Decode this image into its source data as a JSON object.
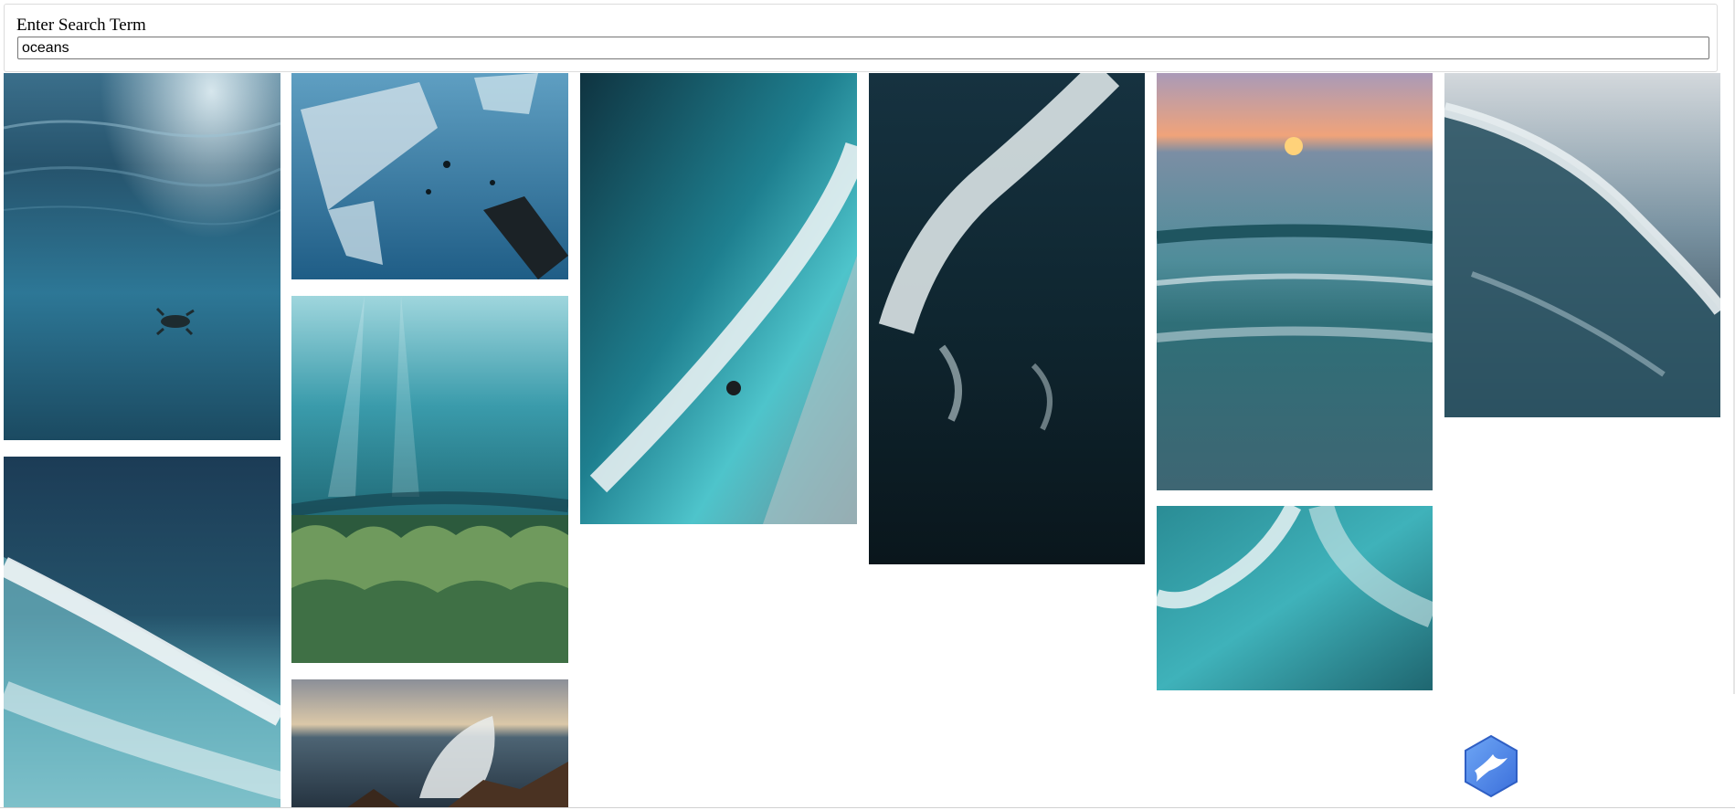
{
  "search": {
    "label": "Enter Search Term",
    "value": "oceans"
  },
  "gallery": {
    "images": [
      {
        "id": "img-turtle",
        "subject": "turtle swimming in deep blue ocean"
      },
      {
        "id": "img-wave-breaking",
        "subject": "wave breaking with white foam"
      },
      {
        "id": "img-plastic",
        "subject": "plastic debris floating underwater"
      },
      {
        "id": "img-coral",
        "subject": "coral reef with sun rays and fish"
      },
      {
        "id": "img-rocks-splash",
        "subject": "wave splashing on rocks at sunset"
      },
      {
        "id": "img-aerial-shore",
        "subject": "aerial view of surf on dark shore"
      },
      {
        "id": "img-aerial-dark",
        "subject": "aerial view of dark ocean with whitecaps"
      },
      {
        "id": "img-sunset-waves",
        "subject": "sunset over shallow waves"
      },
      {
        "id": "img-turquoise-foam",
        "subject": "turquoise water with foam"
      },
      {
        "id": "img-curl-wave",
        "subject": "curling wave under cloudy sky"
      }
    ]
  },
  "badge": {
    "icon": "bird-icon"
  }
}
